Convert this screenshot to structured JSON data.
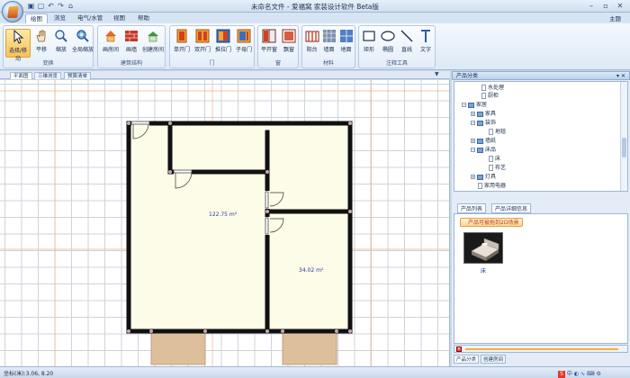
{
  "app": {
    "title": "未命名文件  - 爱福窝 家装设计软件 Beta版",
    "theme_label": "主题"
  },
  "quick_access": [
    "save-icon",
    "new-icon",
    "undo-icon",
    "redo-icon",
    "open-icon"
  ],
  "ribbon_tabs": [
    "绘图",
    "浏览",
    "电气/水管",
    "视图",
    "帮助"
  ],
  "ribbon_groups": {
    "view": {
      "label": "变换",
      "buttons": [
        "选择/移动",
        "平移",
        "缩放",
        "全局缩放"
      ]
    },
    "structure": {
      "label": "建筑结构",
      "buttons": [
        "画房间",
        "画墙",
        "创建房间"
      ]
    },
    "doors": {
      "label": "门",
      "buttons": [
        "单开门",
        "双开门",
        "推拉门",
        "子母门"
      ]
    },
    "windows": {
      "label": "窗",
      "buttons": [
        "平开窗",
        "飘窗"
      ]
    },
    "materials": {
      "label": "材料",
      "buttons": [
        "阳台",
        "墙面",
        "地面"
      ]
    },
    "annot": {
      "label": "注释工具",
      "buttons": [
        "矩形",
        "椭圆",
        "直线",
        "文字"
      ]
    }
  },
  "doc_tabs": [
    "平面图",
    "三维浏览",
    "预算清单"
  ],
  "floorplan": {
    "room_big_area": "122.75 m²",
    "room_small_area": "34.02 m²"
  },
  "panel": {
    "title": "产品分类",
    "tree": [
      {
        "label": "水处理",
        "level": 3,
        "kind": "page"
      },
      {
        "label": "厨柜",
        "level": 3,
        "kind": "page"
      },
      {
        "label": "家居",
        "level": 1,
        "kind": "folder",
        "expander": "−"
      },
      {
        "label": "家具",
        "level": 2,
        "kind": "folder",
        "expander": "+"
      },
      {
        "label": "装饰",
        "level": 2,
        "kind": "folder",
        "expander": "−"
      },
      {
        "label": "地毯",
        "level": 3,
        "kind": "page"
      },
      {
        "label": "墙纸",
        "level": 2,
        "kind": "folder",
        "expander": "+"
      },
      {
        "label": "床品",
        "level": 2,
        "kind": "folder",
        "expander": "−"
      },
      {
        "label": "床",
        "level": 3,
        "kind": "page"
      },
      {
        "label": "布艺",
        "level": 3,
        "kind": "page"
      },
      {
        "label": "灯具",
        "level": 2,
        "kind": "folder",
        "expander": "+"
      },
      {
        "label": "家用电器",
        "level": 2,
        "kind": "page"
      }
    ],
    "tabs": [
      "产品列表",
      "产品详细信息"
    ],
    "crumb": "产品可被拖到2D场景",
    "product_name": "床",
    "bottom_tabs": [
      "产品分类",
      "创建房间"
    ]
  },
  "status": {
    "coords": "坐标(米):3.06, 8.20"
  },
  "colors": {
    "wall": "#111111",
    "floor": "#fdfce8",
    "balcony": "#ddbf9c",
    "accent_grid": "#cdd4de",
    "orange_grid": "#f2b089"
  }
}
